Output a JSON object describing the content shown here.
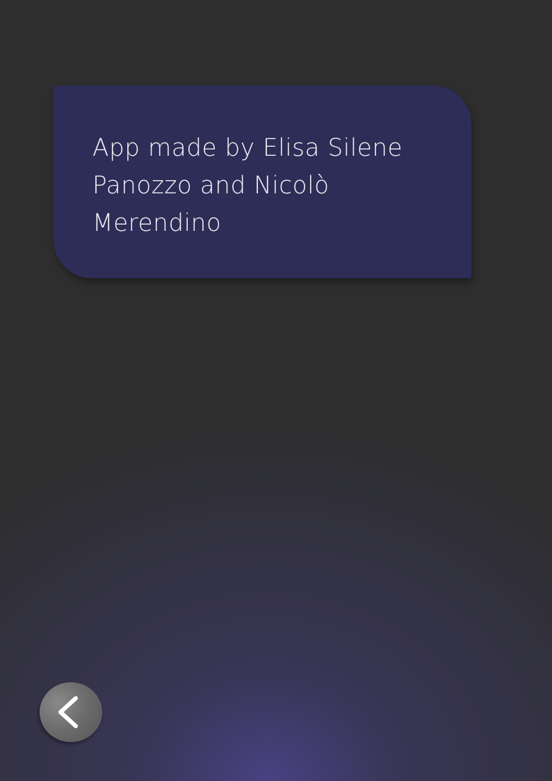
{
  "credits": {
    "text": "App made by Elisa Silene Panozzo and Nicolò Merendino"
  },
  "back_button": {
    "icon": "chevron-left-icon"
  },
  "colors": {
    "background": "#2e2e2e",
    "card": "#2e2d57",
    "glow": "#484282",
    "button": "#6d6d6d",
    "text": "#f2f2f6"
  }
}
